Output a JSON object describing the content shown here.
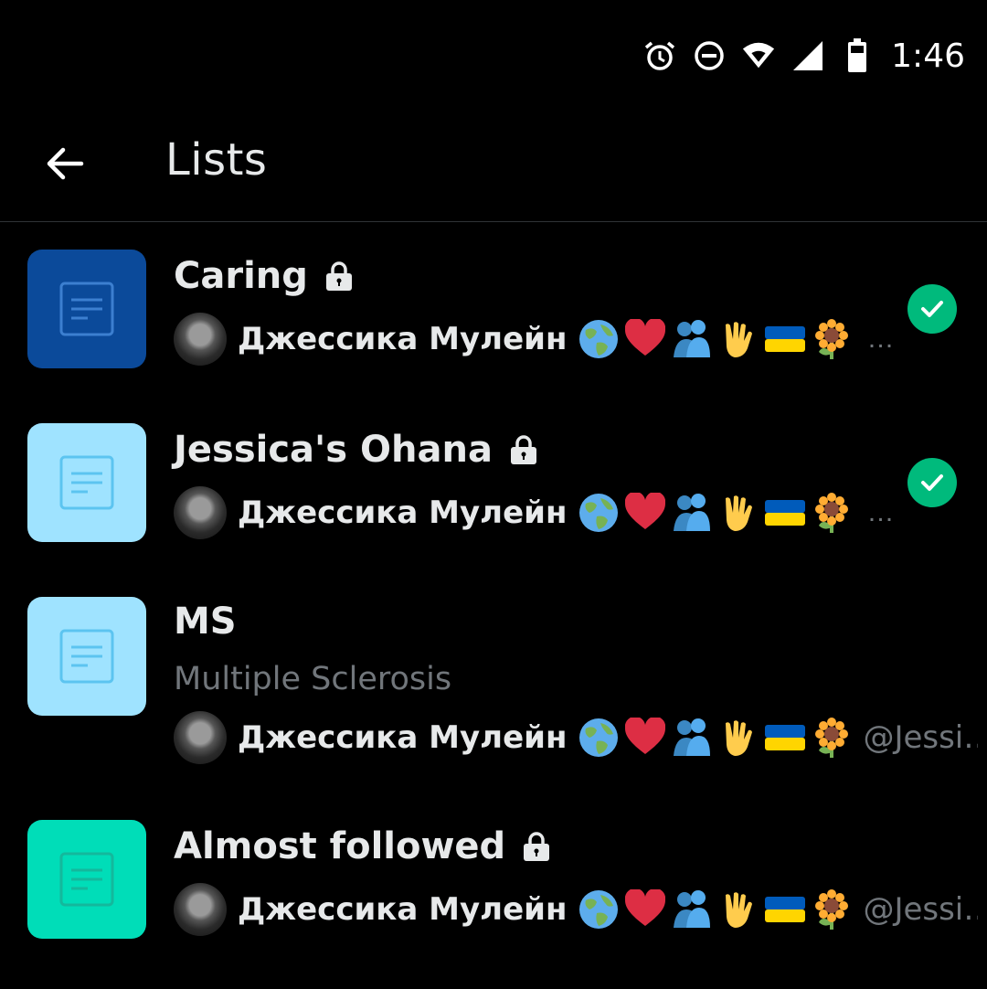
{
  "status_bar": {
    "time": "1:46",
    "icons": [
      "alarm-icon",
      "do-not-disturb-icon",
      "wifi-icon",
      "cell-signal-icon",
      "battery-icon"
    ]
  },
  "header": {
    "title": "Lists",
    "back_icon": "back-arrow-icon"
  },
  "colors": {
    "background": "#000000",
    "divider": "#2f3336",
    "text_primary": "#e7e9ea",
    "text_secondary": "#71767b",
    "check_green": "#00ba7c"
  },
  "lists": [
    {
      "name": "Caring",
      "private": true,
      "description": "",
      "thumb_color": "#0b4a9a",
      "icon_color": "#3c7fd0",
      "owner": "Джессика Мулейн",
      "owner_emojis": [
        "globe-icon",
        "heart-icon",
        "hug-icon",
        "vulcan-salute-icon",
        "ukraine-flag-icon",
        "sunflower-icon"
      ],
      "trailing": "…",
      "selected": true
    },
    {
      "name": "Jessica's Ohana",
      "private": true,
      "description": "",
      "thumb_color": "#9fe3ff",
      "icon_color": "#5cc4f0",
      "owner": "Джессика Мулейн",
      "owner_emojis": [
        "globe-icon",
        "heart-icon",
        "hug-icon",
        "vulcan-salute-icon",
        "ukraine-flag-icon",
        "sunflower-icon"
      ],
      "trailing": "…",
      "selected": true
    },
    {
      "name": "MS",
      "private": false,
      "description": "Multiple Sclerosis",
      "thumb_color": "#9fe3ff",
      "icon_color": "#5cc4f0",
      "owner": "Джессика Мулейн",
      "owner_emojis": [
        "globe-icon",
        "heart-icon",
        "hug-icon",
        "vulcan-salute-icon",
        "ukraine-flag-icon",
        "sunflower-icon"
      ],
      "trailing": "@Jessi…",
      "selected": false
    },
    {
      "name": "Almost followed",
      "private": true,
      "description": "",
      "thumb_color": "#00ddb8",
      "icon_color": "#14b89c",
      "owner": "Джессика Мулейн",
      "owner_emojis": [
        "globe-icon",
        "heart-icon",
        "hug-icon",
        "vulcan-salute-icon",
        "ukraine-flag-icon",
        "sunflower-icon"
      ],
      "trailing": "@Jessi…",
      "selected": false
    }
  ]
}
